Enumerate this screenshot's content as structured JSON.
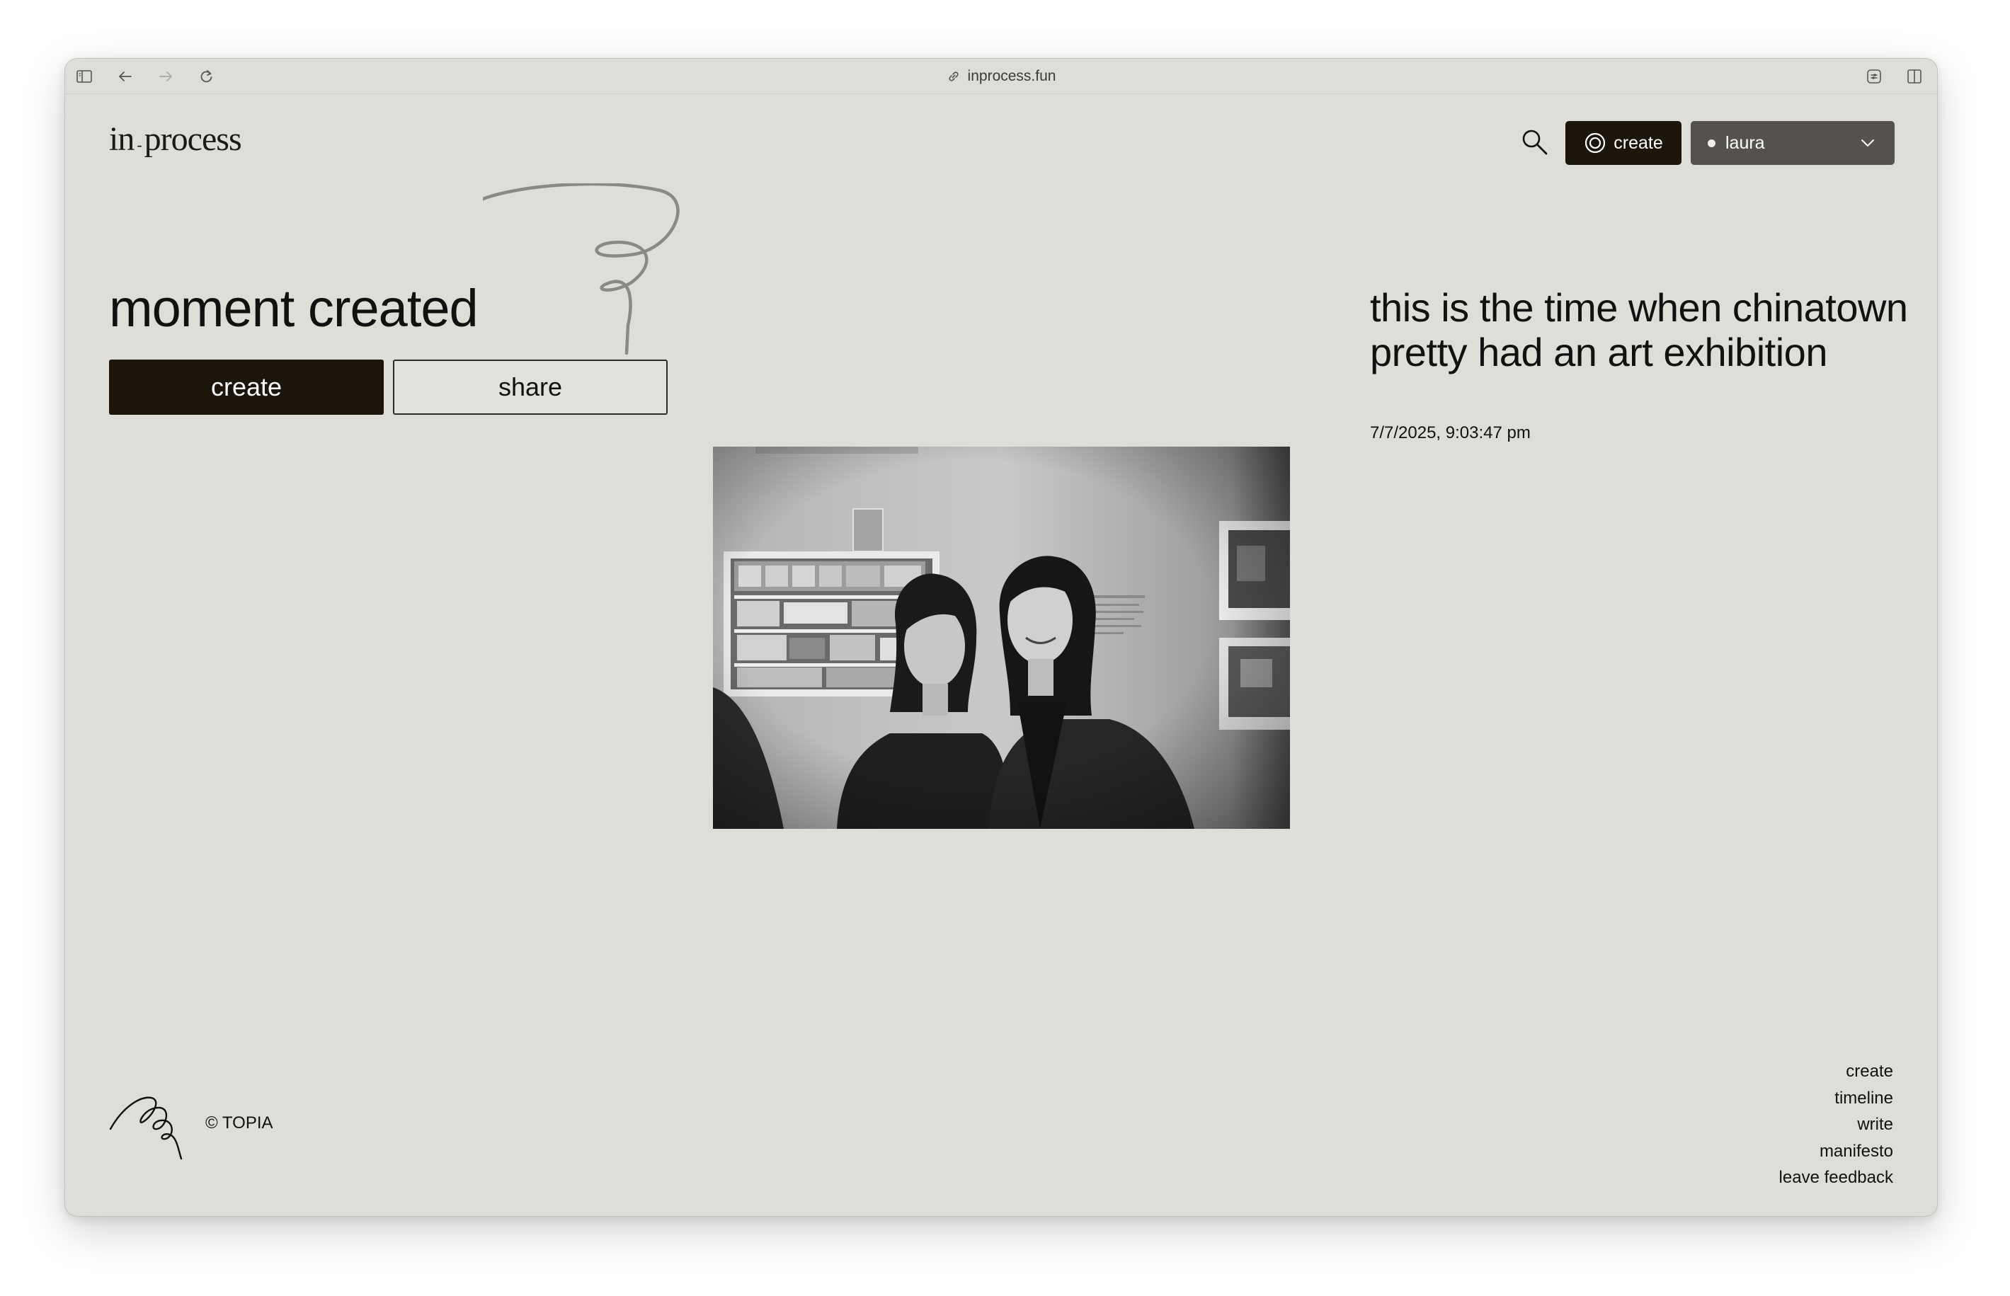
{
  "browser": {
    "url": "inprocess.fun"
  },
  "header": {
    "logo_left": "in",
    "logo_hyphen": "-",
    "logo_right": "process",
    "create_label": "create",
    "user_name": "laura"
  },
  "main": {
    "headline": "moment created",
    "create_button": "create",
    "share_button": "share"
  },
  "moment": {
    "title": "this is the time when chinatown pretty had an art exhibition",
    "timestamp": "7/7/2025, 9:03:47 pm"
  },
  "footer": {
    "copyright": "© TOPIA",
    "links": [
      "create",
      "timeline",
      "write",
      "manifesto",
      "leave feedback"
    ]
  },
  "icons": {
    "sidebar": "sidebar-icon",
    "back": "back-arrow-icon",
    "forward": "forward-arrow-icon",
    "reload": "reload-icon",
    "link": "link-icon",
    "extensions": "extension-icon",
    "split_view": "split-view-icon",
    "search": "search-icon",
    "create_ring": "ring-icon",
    "dropdown": "chevron-down-icon"
  },
  "colors": {
    "background": "#dfddd8",
    "primary_dark": "#1c1509",
    "user_select": "#55524e"
  }
}
